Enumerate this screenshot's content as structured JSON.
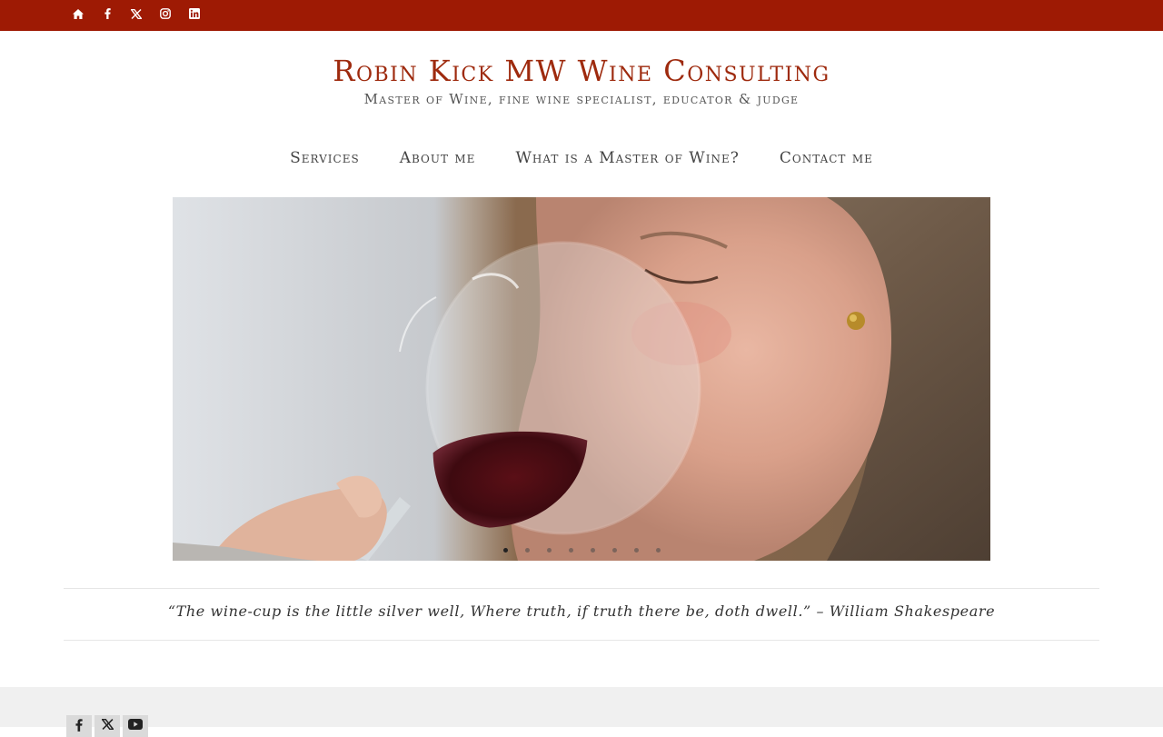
{
  "topbar": {
    "icons": [
      "home-icon",
      "facebook-icon",
      "x-icon",
      "instagram-icon",
      "linkedin-icon"
    ],
    "background": "#9e1a04"
  },
  "header": {
    "title": "Robin Kick MW Wine Consulting",
    "tagline": "Master of Wine, fine wine specialist, educator & judge",
    "title_color": "#9e2a0e"
  },
  "nav": {
    "items": [
      {
        "label": "Services"
      },
      {
        "label": "About me"
      },
      {
        "label": "What is a Master of Wine?"
      },
      {
        "label": "Contact me"
      }
    ]
  },
  "slider": {
    "slide_count": 8,
    "active_slide": 1
  },
  "quote": {
    "text": "“The wine-cup is the little silver well, Where truth, if truth there be, doth dwell.” – William Shakespeare"
  },
  "footer": {
    "icons": [
      "facebook-icon",
      "x-icon",
      "youtube-icon"
    ],
    "background": "#f0f0f0"
  }
}
